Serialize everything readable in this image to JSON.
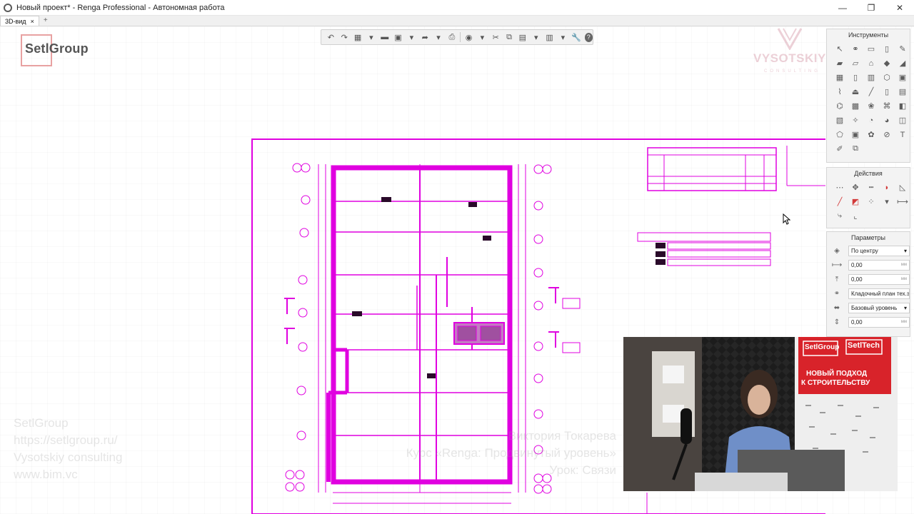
{
  "window": {
    "title": "Новый проект* - Renga Professional - Автономная работа",
    "minimize_glyph": "—",
    "maximize_glyph": "❐",
    "close_glyph": "✕"
  },
  "tabs": [
    {
      "label": "3D-вид",
      "close_glyph": "×"
    }
  ],
  "tab_add_glyph": "+",
  "logo": {
    "text": "SetlGroup"
  },
  "watermark": {
    "brand": "VYSOTSKIY",
    "brand_sub": "CONSULTING",
    "left_lines": [
      "SetlGroup",
      "https://setlgroup.ru/",
      "Vysotskiy consulting",
      "www.bim.vc"
    ],
    "right_lines": [
      "Виктория Токарева",
      "Курс «Renga: Продвинутый уровень»",
      "Урок: Связи"
    ]
  },
  "panels": {
    "tools": {
      "title": "Инструменты"
    },
    "actions": {
      "title": "Действия"
    },
    "params": {
      "title": "Параметры",
      "rows": [
        {
          "value": "По центру",
          "unit": "",
          "dropdown": true
        },
        {
          "value": "0,00",
          "unit": "мм"
        },
        {
          "value": "0,00",
          "unit": "мм"
        },
        {
          "value": "Кладочный план тех.эт",
          "unit": ""
        },
        {
          "value": "Базовый уровень",
          "unit": "",
          "dropdown": true
        },
        {
          "value": "0,00",
          "unit": "мм"
        }
      ]
    }
  },
  "video": {
    "banner_logo_1": "SetlGroup",
    "banner_logo_2": "SetlTech",
    "banner_line_1": "НОВЫЙ ПОДХОД",
    "banner_line_2": "К СТРОИТЕЛЬСТВУ"
  },
  "colors": {
    "accent_magenta": "#e000e0",
    "banner_red": "#d8232a",
    "icon_red": "#d23a3a"
  }
}
